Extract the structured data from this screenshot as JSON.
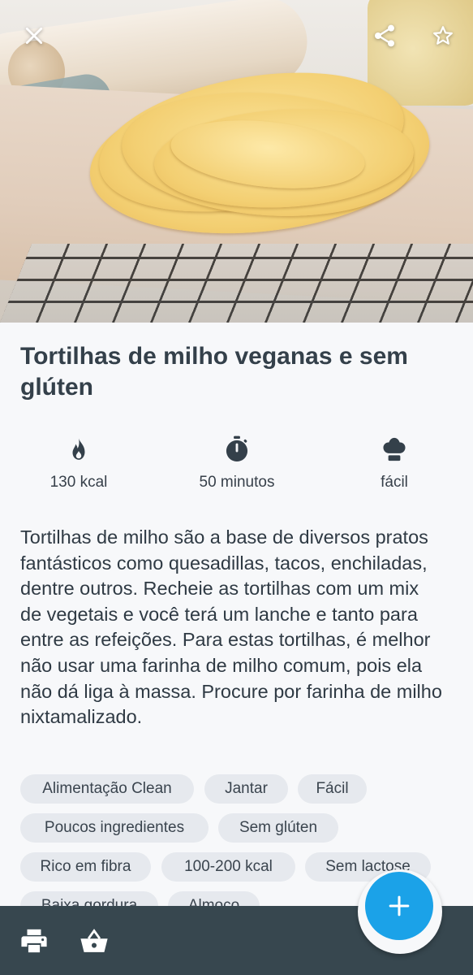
{
  "recipe": {
    "title": "Tortilhas de milho veganas e sem glúten",
    "description": "Tortilhas de milho são a base de diversos pratos fantásticos como quesadillas, tacos, enchiladas, dentre outros. Recheie as tortilhas com um mix de vegetais e você terá um lanche e tanto para entre as refeições. Para estas tortilhas, é melhor não usar uma farinha de milho comum, pois ela não dá liga à massa. Procure por farinha de milho nixtamalizado."
  },
  "stats": {
    "calories": "130 kcal",
    "time": "50 minutos",
    "difficulty": "fácil"
  },
  "tags": [
    "Alimentação Clean",
    "Jantar",
    "Fácil",
    "Poucos ingredientes",
    "Sem glúten",
    "Rico em fibra",
    "100-200 kcal",
    "Sem lactose",
    "Baixa gordura",
    "Almoço"
  ],
  "icons": {
    "close": "close-icon",
    "share": "share-icon",
    "favorite": "star-icon",
    "calories": "flame-icon",
    "time": "stopwatch-icon",
    "difficulty": "chef-hat-icon",
    "print": "printer-icon",
    "basket": "basket-icon",
    "add": "plus-icon"
  },
  "colors": {
    "accent": "#1ba2e8",
    "bottom_bar": "#37474f",
    "chip_bg": "#e6e9ee",
    "text": "#34404a"
  }
}
